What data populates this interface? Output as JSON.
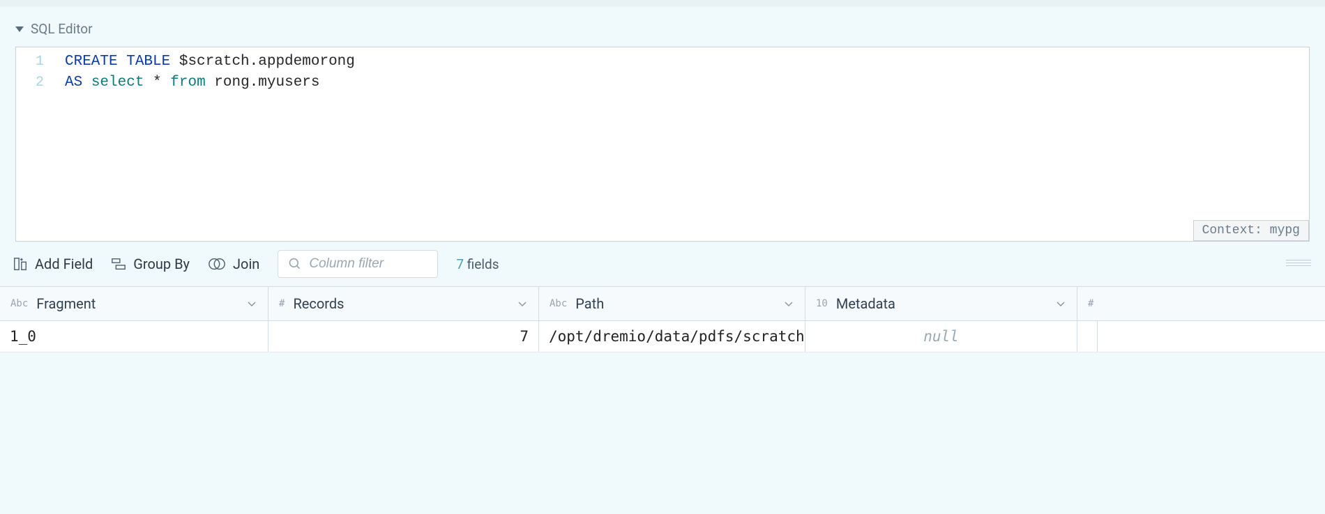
{
  "editor": {
    "title": "SQL Editor",
    "lines": [
      {
        "num": "1",
        "tokens": [
          {
            "c": "kw",
            "t": "CREATE TABLE"
          },
          {
            "c": "txt",
            "t": " $scratch.appdemorong"
          }
        ]
      },
      {
        "num": "2",
        "tokens": [
          {
            "c": "kw",
            "t": "AS"
          },
          {
            "c": "txt",
            "t": " "
          },
          {
            "c": "kw2",
            "t": "select"
          },
          {
            "c": "txt",
            "t": " * "
          },
          {
            "c": "kw2",
            "t": "from"
          },
          {
            "c": "txt",
            "t": " rong.myusers"
          }
        ]
      }
    ],
    "context_label": "Context: mypg"
  },
  "toolbar": {
    "add_field": "Add Field",
    "group_by": "Group By",
    "join": "Join",
    "filter_placeholder": "Column filter",
    "fields_count": "7",
    "fields_label": " fields"
  },
  "grid": {
    "columns": [
      {
        "type": "Abc",
        "label": "Fragment"
      },
      {
        "type": "#",
        "label": "Records"
      },
      {
        "type": "Abc",
        "label": "Path"
      },
      {
        "type": "10",
        "label": "Metadata"
      }
    ],
    "extra_type_icon": "#",
    "rows": [
      {
        "fragment": "1_0",
        "records": "7",
        "path": "/opt/dremio/data/pdfs/scratch/ap",
        "metadata": "null"
      }
    ]
  }
}
